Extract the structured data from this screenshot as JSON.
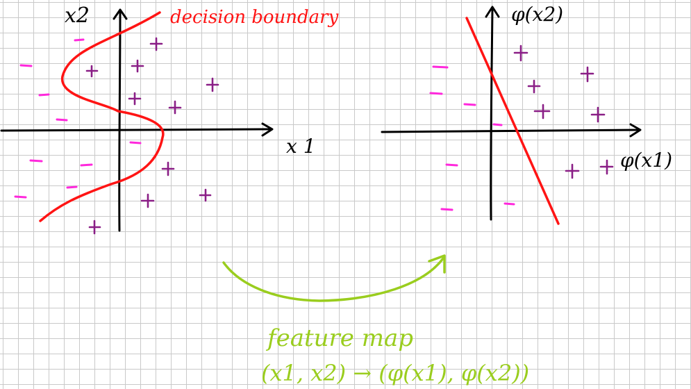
{
  "left_plot": {
    "x_axis_label": "x 1",
    "y_axis_label": "x2",
    "boundary_label": "decision boundary"
  },
  "right_plot": {
    "x_axis_label": "φ(x1)",
    "y_axis_label": "φ(x2)"
  },
  "arrow": {
    "caption": "feature map",
    "formula": "(x1, x2) → (φ(x1), φ(x2))"
  },
  "colors": {
    "plus": "#8a1e86",
    "minus": "#ff28dc",
    "boundary": "#ff1414",
    "feature_map": "#9acd1e",
    "grid": "#c9c9c9"
  },
  "icons": [
    "plus-sign",
    "minus-sign",
    "curved-arrow"
  ]
}
